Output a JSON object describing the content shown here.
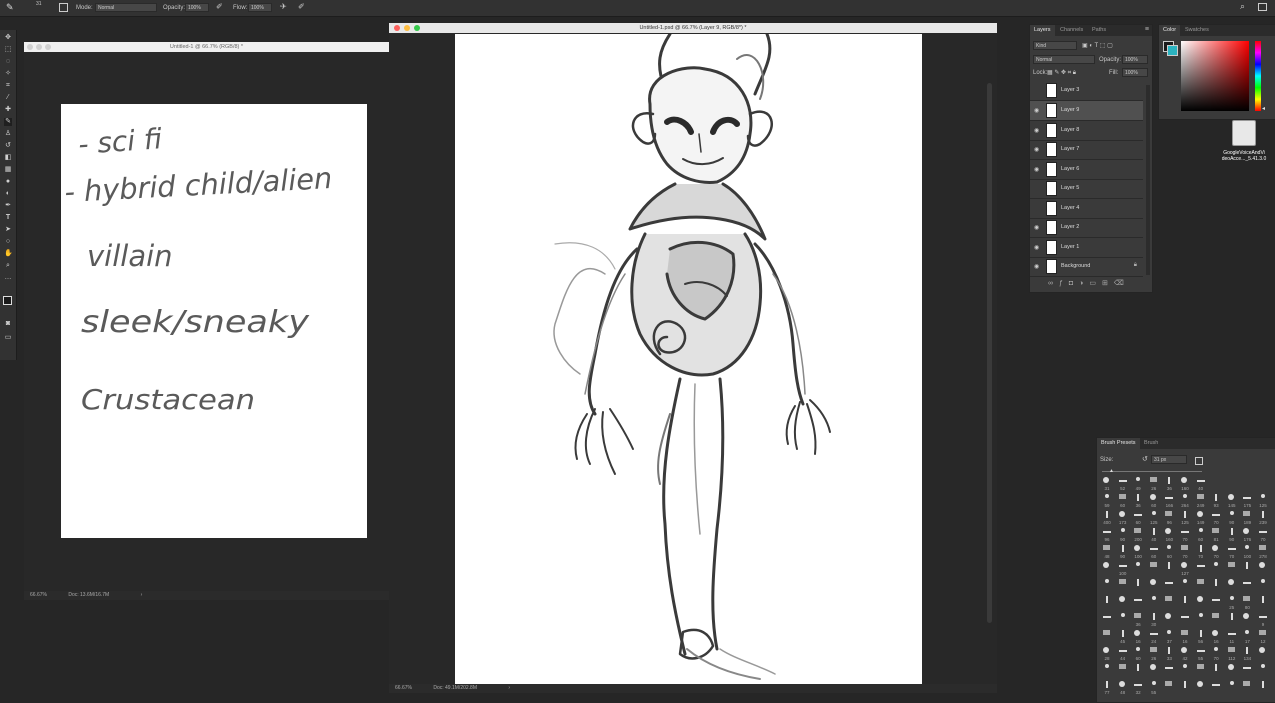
{
  "options_bar": {
    "mode_label": "Mode:",
    "mode_value": "Normal",
    "opacity_label": "Opacity:",
    "opacity_value": "100%",
    "flow_label": "Flow:",
    "flow_value": "100%"
  },
  "left_window": {
    "title": "Untitled-1 @ 66.7% (RGB/8) *",
    "zoom": "66.67%",
    "doc": "Doc: 13.6M/16.7M",
    "notes": [
      "- sci fi",
      "- hybrid child/alien",
      "villain",
      "sleek/sneaky",
      "Crustacean"
    ]
  },
  "main_window": {
    "title": "Untitled-1.psd @ 66.7% (Layer 9, RGB/8*) *",
    "zoom": "66.67%",
    "doc": "Doc: 49.1M/202.8M"
  },
  "layers_panel": {
    "tabs": [
      "Layers",
      "Channels",
      "Paths"
    ],
    "kind": "Kind",
    "blend_mode": "Normal",
    "opacity_label": "Opacity:",
    "opacity_value": "100%",
    "lock_label": "Lock:",
    "fill_label": "Fill:",
    "fill_value": "100%",
    "layers": [
      {
        "name": "Layer 3",
        "visible": false
      },
      {
        "name": "Layer 9",
        "visible": true
      },
      {
        "name": "Layer 8",
        "visible": true
      },
      {
        "name": "Layer 7",
        "visible": true
      },
      {
        "name": "Layer 6",
        "visible": true
      },
      {
        "name": "Layer 5",
        "visible": false
      },
      {
        "name": "Layer 4",
        "visible": false
      },
      {
        "name": "Layer 2",
        "visible": true
      },
      {
        "name": "Layer 1",
        "visible": true
      },
      {
        "name": "Background",
        "visible": true
      }
    ],
    "footer_icons": [
      "link-icon",
      "fx-icon",
      "mask-icon",
      "adjustment-icon",
      "folder-icon",
      "new-layer-icon",
      "trash-icon"
    ]
  },
  "color_panel": {
    "tabs": [
      "Color",
      "Swatches"
    ],
    "hue_color": "#ff0000"
  },
  "desktop_icon": {
    "label_line1": "GoogleVoiceAndVi",
    "label_line2": "deoAcce..._5.41.3.0"
  },
  "brush_panel": {
    "tabs": [
      "Brush Presets",
      "Brush"
    ],
    "size_label": "Size:",
    "size_value": "31 px",
    "brush_rows": [
      [
        "31",
        "52",
        "49",
        "26",
        "36",
        "160",
        "40"
      ],
      [
        "59",
        "60",
        "36",
        "60",
        "166",
        "264",
        "249",
        "93",
        "145",
        "175",
        "125"
      ],
      [
        "400",
        "173",
        "60",
        "125",
        "96",
        "125",
        "149",
        "70",
        "90",
        "189",
        "239"
      ],
      [
        "96",
        "90",
        "200",
        "40",
        "160",
        "70",
        "60",
        "81",
        "90",
        "176",
        "70"
      ],
      [
        "48",
        "90",
        "100",
        "60",
        "60",
        "70",
        "70",
        "70",
        "70",
        "100",
        "278"
      ],
      [
        "",
        "100",
        "",
        "",
        "",
        "127",
        "",
        "",
        "",
        "",
        ""
      ],
      [
        "",
        "",
        "",
        "",
        "",
        "",
        "",
        "",
        "",
        "",
        ""
      ],
      [
        "",
        "",
        "",
        "",
        "",
        "",
        "",
        "",
        "25",
        "80",
        ""
      ],
      [
        "",
        "",
        "36",
        "30",
        "",
        "",
        "",
        "",
        "",
        "",
        "9"
      ],
      [
        "",
        "45",
        "16",
        "24",
        "37",
        "16",
        "56",
        "16",
        "11",
        "17",
        "12"
      ],
      [
        "28",
        "44",
        "60",
        "26",
        "33",
        "42",
        "55",
        "70",
        "112",
        "134",
        ""
      ],
      [
        "",
        "",
        "",
        "",
        "",
        "",
        "",
        "",
        "",
        "",
        ""
      ],
      [
        "77",
        "48",
        "32",
        "55",
        "",
        "",
        "",
        "",
        "",
        "",
        ""
      ]
    ]
  }
}
